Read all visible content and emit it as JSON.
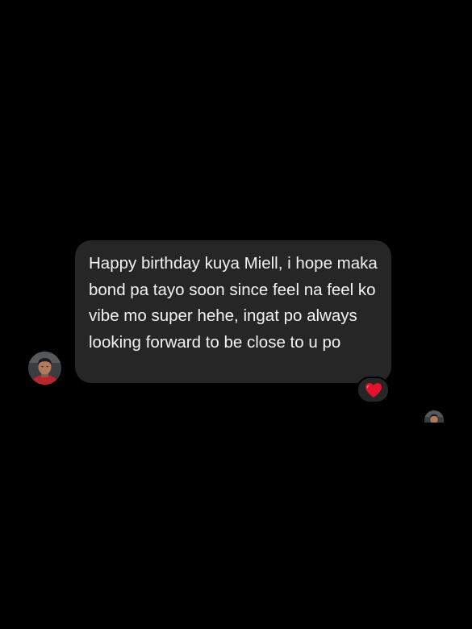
{
  "conversation": {
    "message": {
      "text": "Happy birthday kuya Miell, i hope maka bond pa tayo soon since feel na feel ko vibe mo super hehe, ingat po always looking forward to be close to u po",
      "reaction": "heart-emoji"
    },
    "sender": {
      "avatar_icon": "person-avatar-icon"
    },
    "read_receipt": {
      "avatar_icon": "person-avatar-icon"
    }
  },
  "colors": {
    "background": "#000000",
    "bubble": "#262626",
    "text": "#f2f2f2",
    "heart": "#e0142c"
  }
}
